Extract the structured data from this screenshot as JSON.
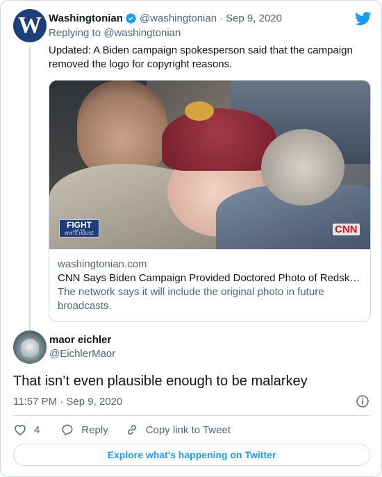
{
  "parent_tweet": {
    "author_name": "Washingtonian",
    "author_handle": "@washingtonian",
    "separator": "·",
    "date": "Sep 9, 2020",
    "replying_to": "Replying to @washingtonian",
    "text": "Updated: A Biden campaign spokesperson said that the campaign removed the logo for copyright reasons.",
    "avatar_letter": "W",
    "card": {
      "domain": "washingtonian.com",
      "title": "CNN Says Biden Campaign Provided Doctored Photo of Redsk…",
      "description": "The network says it will include the original photo in future broadcasts.",
      "overlay_left": "FIGHT",
      "overlay_left_small": "FOR THE",
      "overlay_left_sub": "WHITE HOUSE",
      "overlay_right": "CNN"
    }
  },
  "tweet": {
    "author_name": "maor eichler",
    "author_handle": "@EichlerMaor",
    "text": "That isn’t even plausible enough to be malarkey",
    "timestamp": "11:57 PM · Sep 9, 2020"
  },
  "actions": {
    "like_count": "4",
    "reply_label": "Reply",
    "copy_label": "Copy link to Tweet"
  },
  "explore_label": "Explore what's happening on Twitter",
  "icons": {
    "verified": "verified-badge-icon",
    "twitter": "twitter-bird-icon",
    "info": "info-icon",
    "like": "heart-icon",
    "reply": "reply-bubble-icon",
    "copy": "link-icon"
  },
  "colors": {
    "accent": "#1d9bf0",
    "text_primary": "#0f1419",
    "text_secondary": "#536471",
    "border": "#cfd9de"
  }
}
